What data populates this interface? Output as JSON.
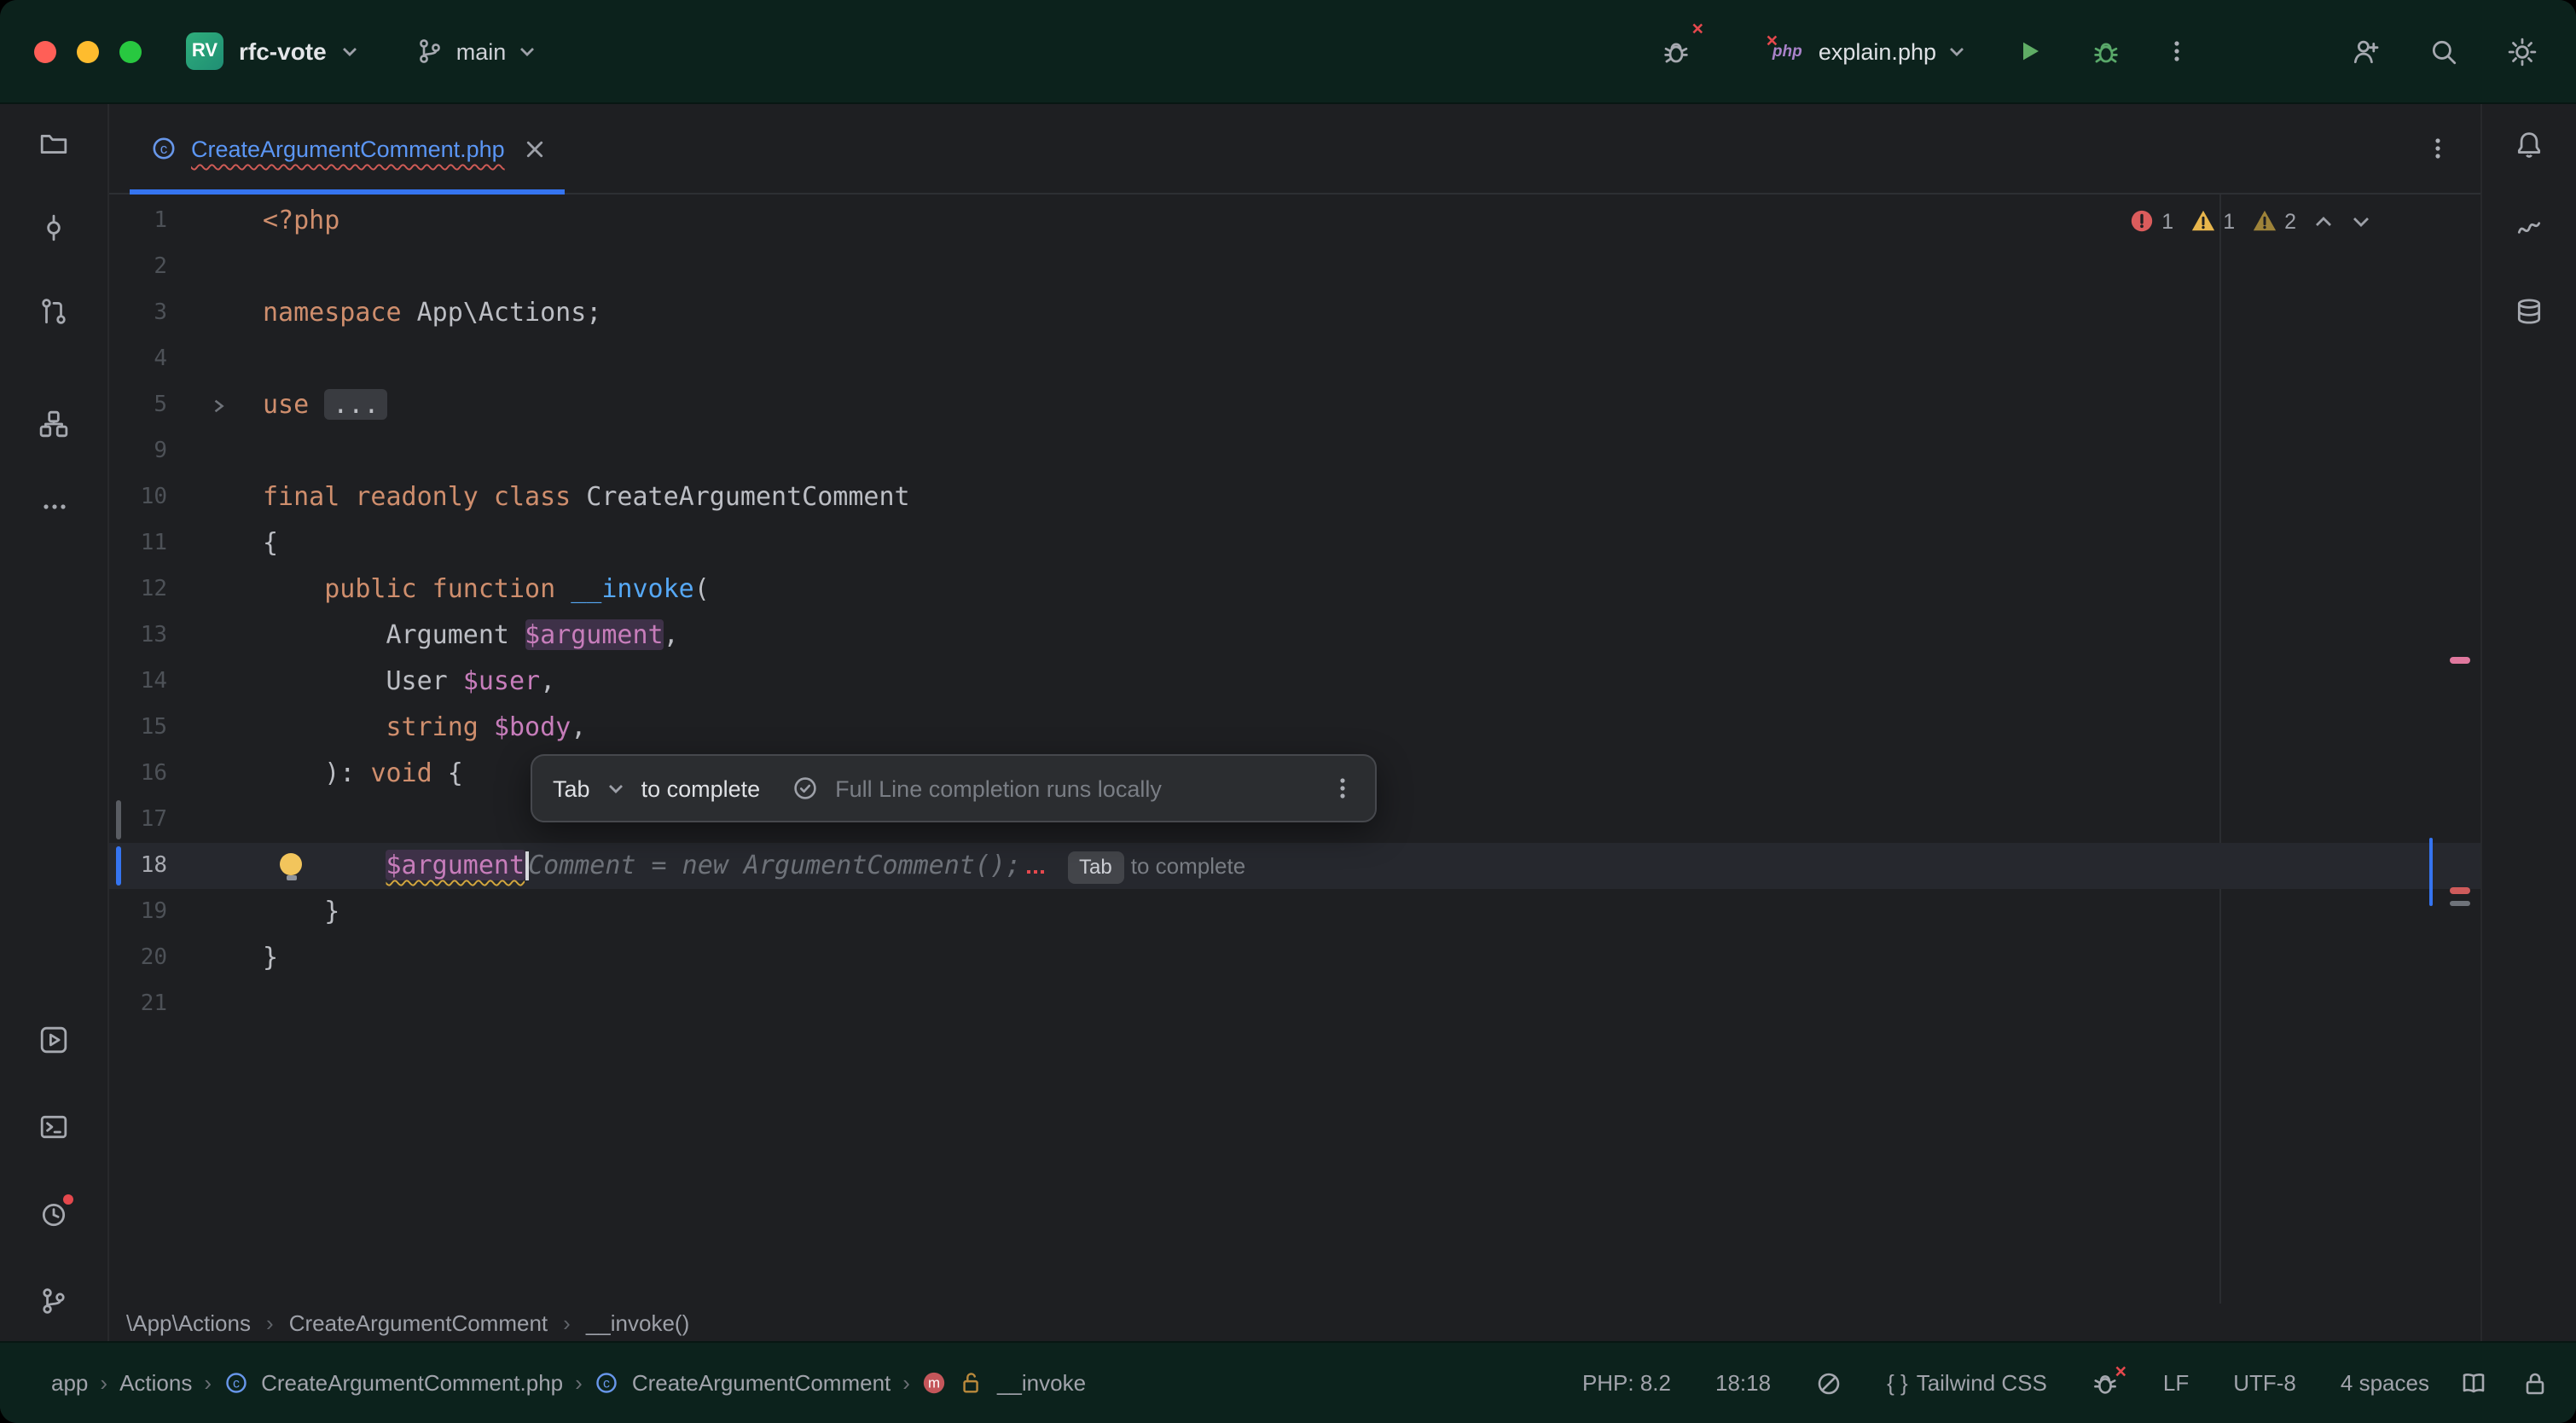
{
  "colors": {
    "accent": "#3574F0",
    "titlebar_bg": "#0C221C",
    "editor_bg": "#1E1F22",
    "error": "#E5484D",
    "warning": "#E8B64C",
    "keyword_orange": "#CF8E6D",
    "variable_purple": "#C77DBB",
    "function_blue": "#56A8F5",
    "modified_file_blue": "#5B96F5",
    "run_green": "#5FAD65"
  },
  "titlebar": {
    "project_badge": "RV",
    "project_name": "rfc-vote",
    "branch": "main",
    "run_config": "explain.php"
  },
  "left_bar_icons": [
    "project-folder",
    "commit",
    "pull-requests",
    "structure",
    "more",
    "run",
    "terminal",
    "problems",
    "version-control"
  ],
  "right_bar_icons": [
    "notifications",
    "ai-assistant",
    "database"
  ],
  "tab": {
    "title": "CreateArgumentComment.php"
  },
  "editor": {
    "inspections": {
      "errors": "1",
      "warnings": "1",
      "weak_warnings": "2"
    },
    "completion_popup": {
      "key": "Tab",
      "action": "to complete",
      "note": "Full Line completion runs locally"
    },
    "lines": [
      {
        "n": "1",
        "tokens": [
          {
            "c": "kw",
            "t": "<?php"
          }
        ]
      },
      {
        "n": "2",
        "tokens": []
      },
      {
        "n": "3",
        "tokens": [
          {
            "c": "kw",
            "t": "namespace"
          },
          {
            "c": "pl",
            "t": " App\\Actions;"
          }
        ]
      },
      {
        "n": "4",
        "tokens": []
      },
      {
        "n": "5",
        "fold": true,
        "tokens": [
          {
            "c": "kw",
            "t": "use"
          },
          {
            "c": "pl",
            "t": " "
          },
          {
            "c": "folded",
            "t": "..."
          }
        ]
      },
      {
        "n": "9",
        "tokens": []
      },
      {
        "n": "10",
        "tokens": [
          {
            "c": "kw",
            "t": "final readonly class"
          },
          {
            "c": "pl",
            "t": " CreateArgumentComment"
          }
        ]
      },
      {
        "n": "11",
        "tokens": [
          {
            "c": "pl",
            "t": "{"
          }
        ]
      },
      {
        "n": "12",
        "tokens": [
          {
            "c": "pl",
            "t": "    "
          },
          {
            "c": "kw",
            "t": "public function"
          },
          {
            "c": "fn",
            "t": " __invoke"
          },
          {
            "c": "pl",
            "t": "("
          }
        ]
      },
      {
        "n": "13",
        "tokens": [
          {
            "c": "pl",
            "t": "        Argument "
          },
          {
            "c": "var hl",
            "t": "$argument"
          },
          {
            "c": "pl",
            "t": ","
          }
        ]
      },
      {
        "n": "14",
        "tokens": [
          {
            "c": "pl",
            "t": "        User "
          },
          {
            "c": "var",
            "t": "$user"
          },
          {
            "c": "pl",
            "t": ","
          }
        ]
      },
      {
        "n": "15",
        "tokens": [
          {
            "c": "pl",
            "t": "        "
          },
          {
            "c": "kw",
            "t": "string"
          },
          {
            "c": "pl",
            "t": " "
          },
          {
            "c": "var",
            "t": "$body"
          },
          {
            "c": "pl",
            "t": ","
          }
        ]
      },
      {
        "n": "16",
        "tokens": [
          {
            "c": "pl",
            "t": "    ): "
          },
          {
            "c": "kw",
            "t": "void"
          },
          {
            "c": "pl",
            "t": " {"
          }
        ]
      },
      {
        "n": "17",
        "marker": "grey",
        "tokens": []
      },
      {
        "n": "18",
        "current": true,
        "bulb": true,
        "marker": "blue",
        "tokens": [
          {
            "c": "pl",
            "t": "        "
          },
          {
            "c": "var hl warn",
            "t": "$argument"
          },
          {
            "c": "caret",
            "t": ""
          },
          {
            "c": "ghost",
            "t": "Comment = new ArgumentComment();"
          },
          {
            "c": "errmark",
            "t": ""
          },
          {
            "c": "hintkey",
            "t": "Tab"
          },
          {
            "c": "hint",
            "t": "to complete"
          }
        ]
      },
      {
        "n": "19",
        "tokens": [
          {
            "c": "pl",
            "t": "    }"
          }
        ]
      },
      {
        "n": "20",
        "tokens": [
          {
            "c": "pl",
            "t": "}"
          }
        ]
      },
      {
        "n": "21",
        "tokens": []
      }
    ]
  },
  "editor_breadcrumbs": [
    "\\App\\Actions",
    "CreateArgumentComment",
    "__invoke()"
  ],
  "status": {
    "path": [
      "app",
      "Actions",
      "CreateArgumentComment.php",
      "CreateArgumentComment",
      "__invoke"
    ],
    "php_version": "PHP: 8.2",
    "caret_position": "18:18",
    "framework_brackets": "{ }",
    "framework": "Tailwind CSS",
    "line_separator": "LF",
    "encoding": "UTF-8",
    "indent": "4 spaces"
  }
}
